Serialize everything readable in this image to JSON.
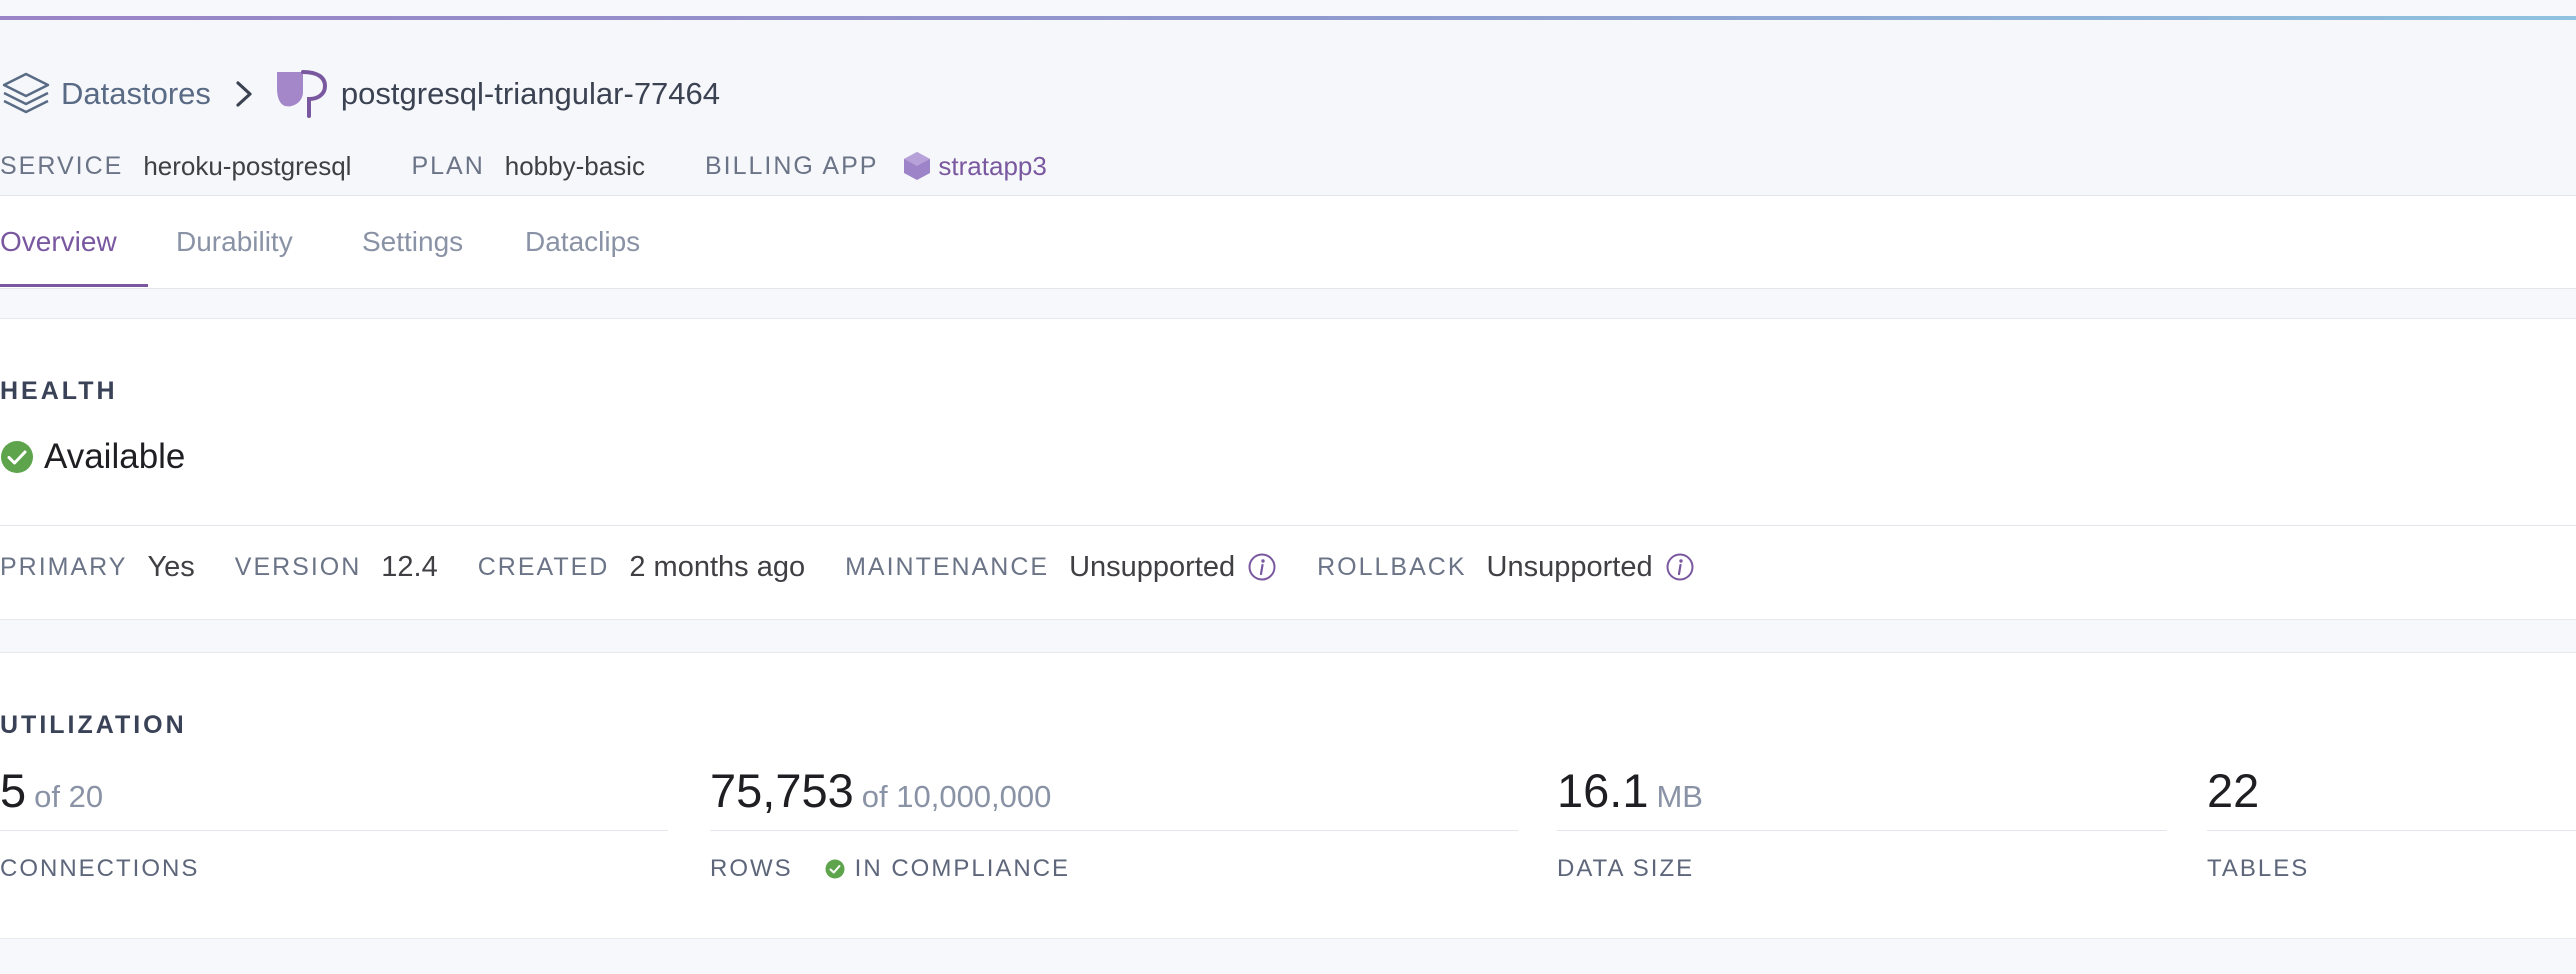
{
  "breadcrumb": {
    "datastores_label": "Datastores",
    "database_name": "postgresql-triangular-77464"
  },
  "meta": {
    "service_key": "SERVICE",
    "service_value": "heroku-postgresql",
    "plan_key": "PLAN",
    "plan_value": "hobby-basic",
    "billing_key": "BILLING APP",
    "billing_value": "stratapp3"
  },
  "tabs": [
    {
      "label": "Overview",
      "active": true
    },
    {
      "label": "Durability",
      "active": false
    },
    {
      "label": "Settings",
      "active": false
    },
    {
      "label": "Dataclips",
      "active": false
    }
  ],
  "health": {
    "title": "HEALTH",
    "status": "Available",
    "status_color": "#5da44d",
    "items": [
      {
        "key": "PRIMARY",
        "value": "Yes"
      },
      {
        "key": "VERSION",
        "value": "12.4"
      },
      {
        "key": "CREATED",
        "value": "2 months ago"
      },
      {
        "key": "MAINTENANCE",
        "value": "Unsupported"
      },
      {
        "key": "ROLLBACK",
        "value": "Unsupported"
      }
    ]
  },
  "utilization": {
    "title": "UTILIZATION",
    "metrics": [
      {
        "value": "5",
        "suffix": "of 20",
        "label": "CONNECTIONS"
      },
      {
        "value": "75,753",
        "suffix": "of 10,000,000",
        "label": "ROWS",
        "badge": "IN COMPLIANCE"
      },
      {
        "value": "16.1",
        "suffix": "MB",
        "label": "DATA SIZE"
      },
      {
        "value": "22",
        "suffix": "",
        "label": "TABLES"
      }
    ]
  },
  "colors": {
    "accent": "#79589f",
    "success": "#5da44d"
  }
}
